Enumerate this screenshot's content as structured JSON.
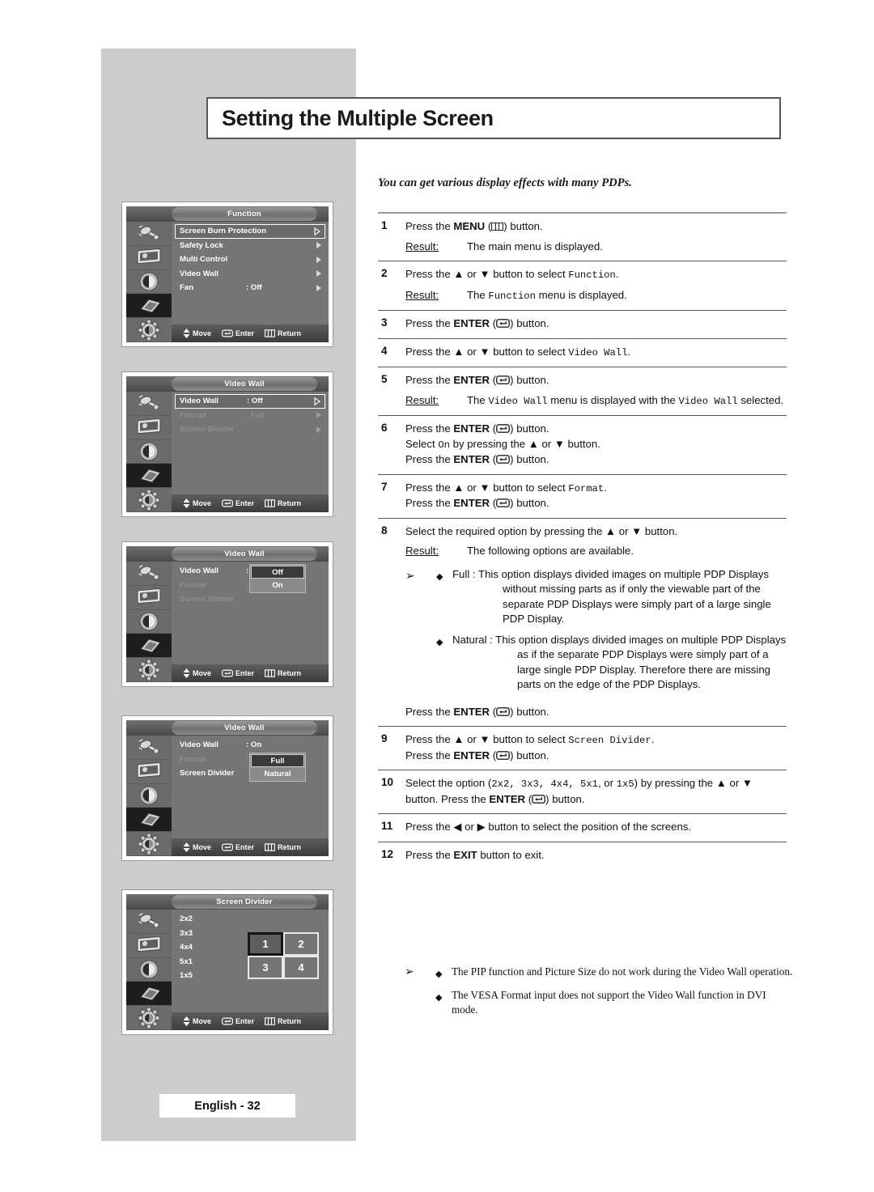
{
  "page": {
    "title": "Setting the Multiple Screen",
    "subtitle": "You can get various display effects with many PDPs.",
    "footer": "English - 32"
  },
  "osd_menus": [
    {
      "id": "function-menu",
      "title": "Function",
      "rows": [
        {
          "label": "Screen Burn Protection",
          "value": "",
          "state": "selected",
          "arrow": "outline"
        },
        {
          "label": "Safety Lock",
          "value": "",
          "state": "normal",
          "arrow": "solid"
        },
        {
          "label": "Multi Control",
          "value": "",
          "state": "normal",
          "arrow": "solid"
        },
        {
          "label": "Video Wall",
          "value": "",
          "state": "normal",
          "arrow": "solid"
        },
        {
          "label": "Fan",
          "value": ": Off",
          "state": "normal",
          "arrow": "solid"
        }
      ]
    },
    {
      "id": "video-wall-menu-off",
      "title": "Video Wall",
      "rows": [
        {
          "label": "Video Wall",
          "value": ": Off",
          "state": "selected",
          "arrow": "outline"
        },
        {
          "label": "Format",
          "value": ": Full",
          "state": "dim",
          "arrow": "solid"
        },
        {
          "label": "Screen Divider",
          "value": "",
          "state": "dim",
          "arrow": "solid"
        }
      ]
    },
    {
      "id": "video-wall-menu-onoff-popup",
      "title": "Video Wall",
      "rows": [
        {
          "label": "Video Wall",
          "value": ":",
          "state": "normal",
          "arrow": "none"
        },
        {
          "label": "Format",
          "value": ":",
          "state": "dim",
          "arrow": "none"
        },
        {
          "label": "Screen Divider",
          "value": "",
          "state": "dim",
          "arrow": "none"
        }
      ],
      "popup": {
        "options": [
          "Off",
          "On"
        ],
        "highlighted": "Off"
      }
    },
    {
      "id": "video-wall-menu-format-popup",
      "title": "Video Wall",
      "rows": [
        {
          "label": "Video Wall",
          "value": ": On",
          "state": "normal",
          "arrow": "none"
        },
        {
          "label": "Format",
          "value": ":",
          "state": "dim",
          "arrow": "none"
        },
        {
          "label": "Screen Divider",
          "value": "",
          "state": "normal",
          "arrow": "none"
        }
      ],
      "popup": {
        "options": [
          "Full",
          "Natural"
        ],
        "highlighted": "Full"
      }
    },
    {
      "id": "screen-divider-menu",
      "title": "Screen Divider",
      "rows": [
        {
          "label": "2x2",
          "value": "",
          "state": "normal",
          "arrow": "none"
        },
        {
          "label": "3x3",
          "value": "",
          "state": "normal",
          "arrow": "none"
        },
        {
          "label": "4x4",
          "value": "",
          "state": "normal",
          "arrow": "none"
        },
        {
          "label": "5x1",
          "value": "",
          "state": "normal",
          "arrow": "none"
        },
        {
          "label": "1x5",
          "value": "",
          "state": "normal",
          "arrow": "none"
        }
      ],
      "grid": {
        "cells": [
          "1",
          "2",
          "3",
          "4"
        ],
        "highlighted": "1"
      }
    }
  ],
  "osd_bottom_bar": {
    "move_label": "Move",
    "enter_label": "Enter",
    "return_label": "Return"
  },
  "osd_rail_icons": [
    "input-source-icon",
    "picture-display-icon",
    "sound-speaker-icon",
    "function-panel-icon",
    "setup-gear-icon"
  ],
  "steps": [
    {
      "num": "1",
      "line1_a": "Press the ",
      "line1_bold": "MENU",
      "line1_b": " (",
      "line1_c": ") button.",
      "result_label": "Result:",
      "result_text": "The main menu is displayed."
    },
    {
      "num": "2",
      "text_a": "Press the ▲ or ▼ button to select ",
      "text_mono": "Function",
      "text_b": ".",
      "result_label": "Result:",
      "result_a": "The ",
      "result_mono": "Function",
      "result_b": " menu is displayed."
    },
    {
      "num": "3",
      "line1_a": "Press the ",
      "line1_bold": "ENTER",
      "line1_b": " (",
      "line1_c": ") button."
    },
    {
      "num": "4",
      "text_a": "Press the ▲ or ▼ button to select ",
      "text_mono": "Video Wall",
      "text_b": "."
    },
    {
      "num": "5",
      "line1_a": "Press the ",
      "line1_bold": "ENTER",
      "line1_b": " (",
      "line1_c": ") button.",
      "result_label": "Result:",
      "result_a": "The ",
      "result_mono": "Video Wall",
      "result_b": " menu is displayed with the ",
      "result_mono2": "Video Wall",
      "result_c": " selected."
    },
    {
      "num": "6",
      "l1_a": "Press the ",
      "l1_bold": "ENTER",
      "l1_b": " (",
      "l1_c": ") button.",
      "l2_a": "Select ",
      "l2_mono": "On",
      "l2_b": " by pressing the ▲ or ▼ button.",
      "l3_a": "Press the ",
      "l3_bold": "ENTER",
      "l3_b": " (",
      "l3_c": ") button."
    },
    {
      "num": "7",
      "l1_a": "Press the ▲ or ▼ button to select ",
      "l1_mono": "Format",
      "l1_b": ".",
      "l2_a": "Press the ",
      "l2_bold": "ENTER",
      "l2_b": " (",
      "l2_c": ") button."
    },
    {
      "num": "8",
      "text": "Select the required option by pressing the ▲ or ▼ button.",
      "result_label": "Result:",
      "result_text": "The following options are available.",
      "options": [
        {
          "name": "Full : ",
          "desc": "This option displays divided images on multiple PDP Displays without missing parts as if only the viewable part of the separate PDP Displays were simply part of a large single PDP Display."
        },
        {
          "name": "Natural : ",
          "desc": "This option displays divided images on multiple PDP Displays as if the separate PDP Displays were simply part of a large single PDP Display. Therefore  there are missing parts on the edge of the PDP Displays."
        }
      ],
      "trailing_a": "Press the ",
      "trailing_bold": "ENTER",
      "trailing_b": " (",
      "trailing_c": ") button."
    },
    {
      "num": "9",
      "l1_a": "Press the ▲ or ▼ button to select ",
      "l1_mono": "Screen Divider",
      "l1_b": ".",
      "l2_a": "Press the ",
      "l2_bold": "ENTER",
      "l2_b": " (",
      "l2_c": ") button."
    },
    {
      "num": "10",
      "l1_a": "Select the option (",
      "l1_mono": "2x2, 3x3, 4x4, 5x1",
      "l1_b": ", or ",
      "l1_mono2": "1x5",
      "l1_c": ") by pressing the ▲ or ▼ button. Press the ",
      "l1_bold": "ENTER",
      "l1_d": " (",
      "l1_e": ") button."
    },
    {
      "num": "11",
      "text": "Press the ◀ or ▶ button to select the position of the screens."
    },
    {
      "num": "12",
      "text_a": "Press the ",
      "text_bold": "EXIT",
      "text_b": " button to exit."
    }
  ],
  "final_notes": {
    "arrow": "➢",
    "items": [
      "The PIP function and Picture Size do not work during the Video Wall operation.",
      "The VESA Format input does not support the Video Wall function in DVI mode."
    ]
  },
  "symbols": {
    "arrow_marker": "➢",
    "diamond": "◆"
  }
}
